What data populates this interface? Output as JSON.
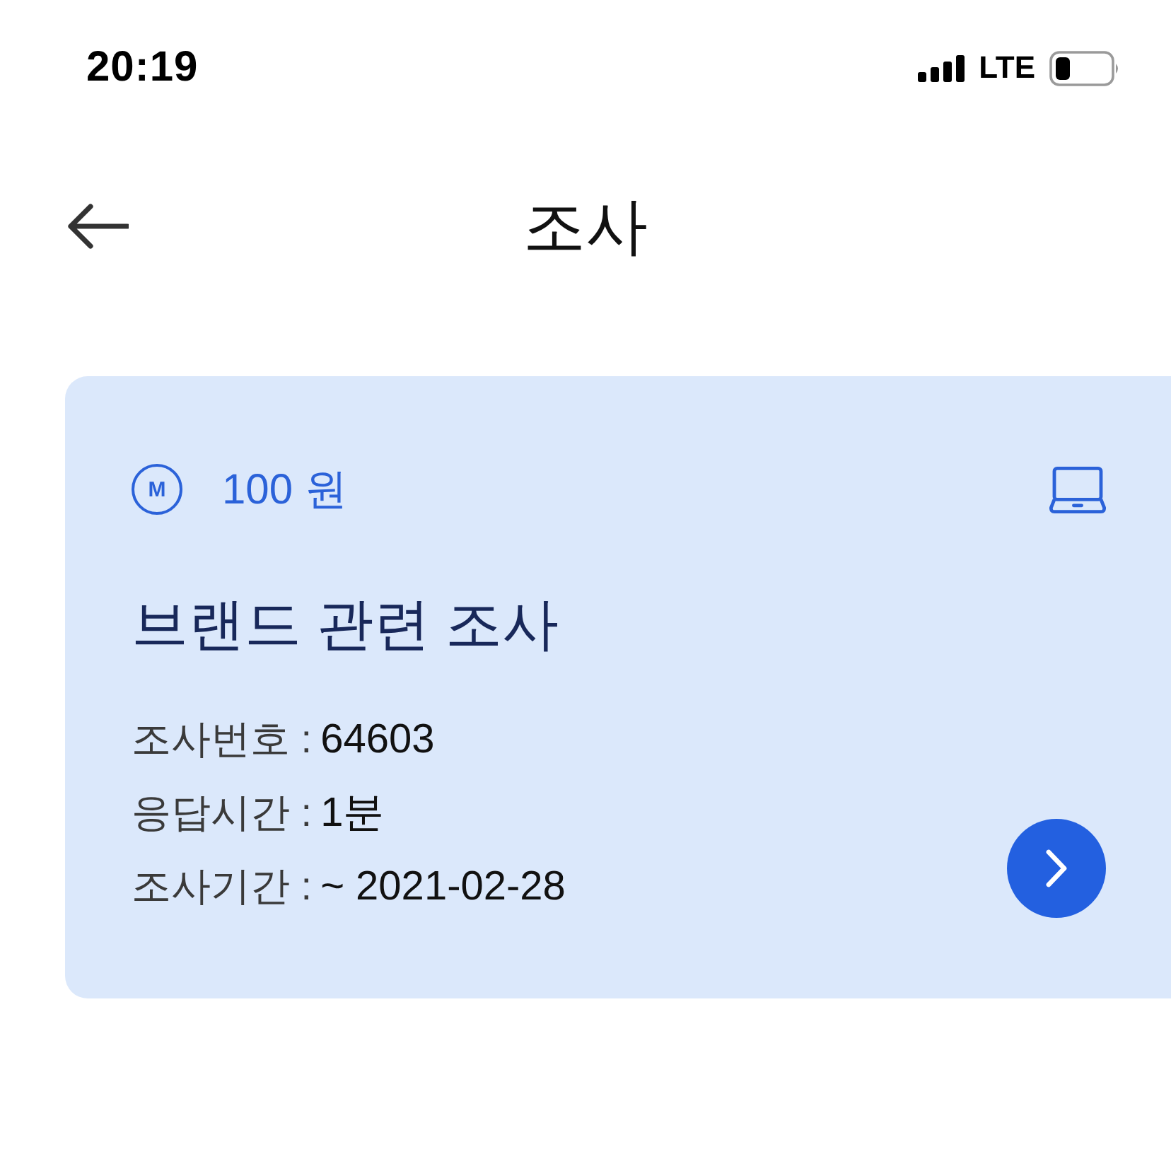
{
  "status_bar": {
    "time": "20:19",
    "network": "LTE"
  },
  "header": {
    "title": "조사"
  },
  "survey_card": {
    "reward": {
      "icon_letter": "M",
      "amount": "100 원"
    },
    "title": "브랜드 관련 조사",
    "details": [
      {
        "label": "조사번호 :",
        "value": "64603"
      },
      {
        "label": "응답시간 :",
        "value": "1분"
      },
      {
        "label": "조사기간 :",
        "value": "~ 2021-02-28"
      }
    ]
  }
}
